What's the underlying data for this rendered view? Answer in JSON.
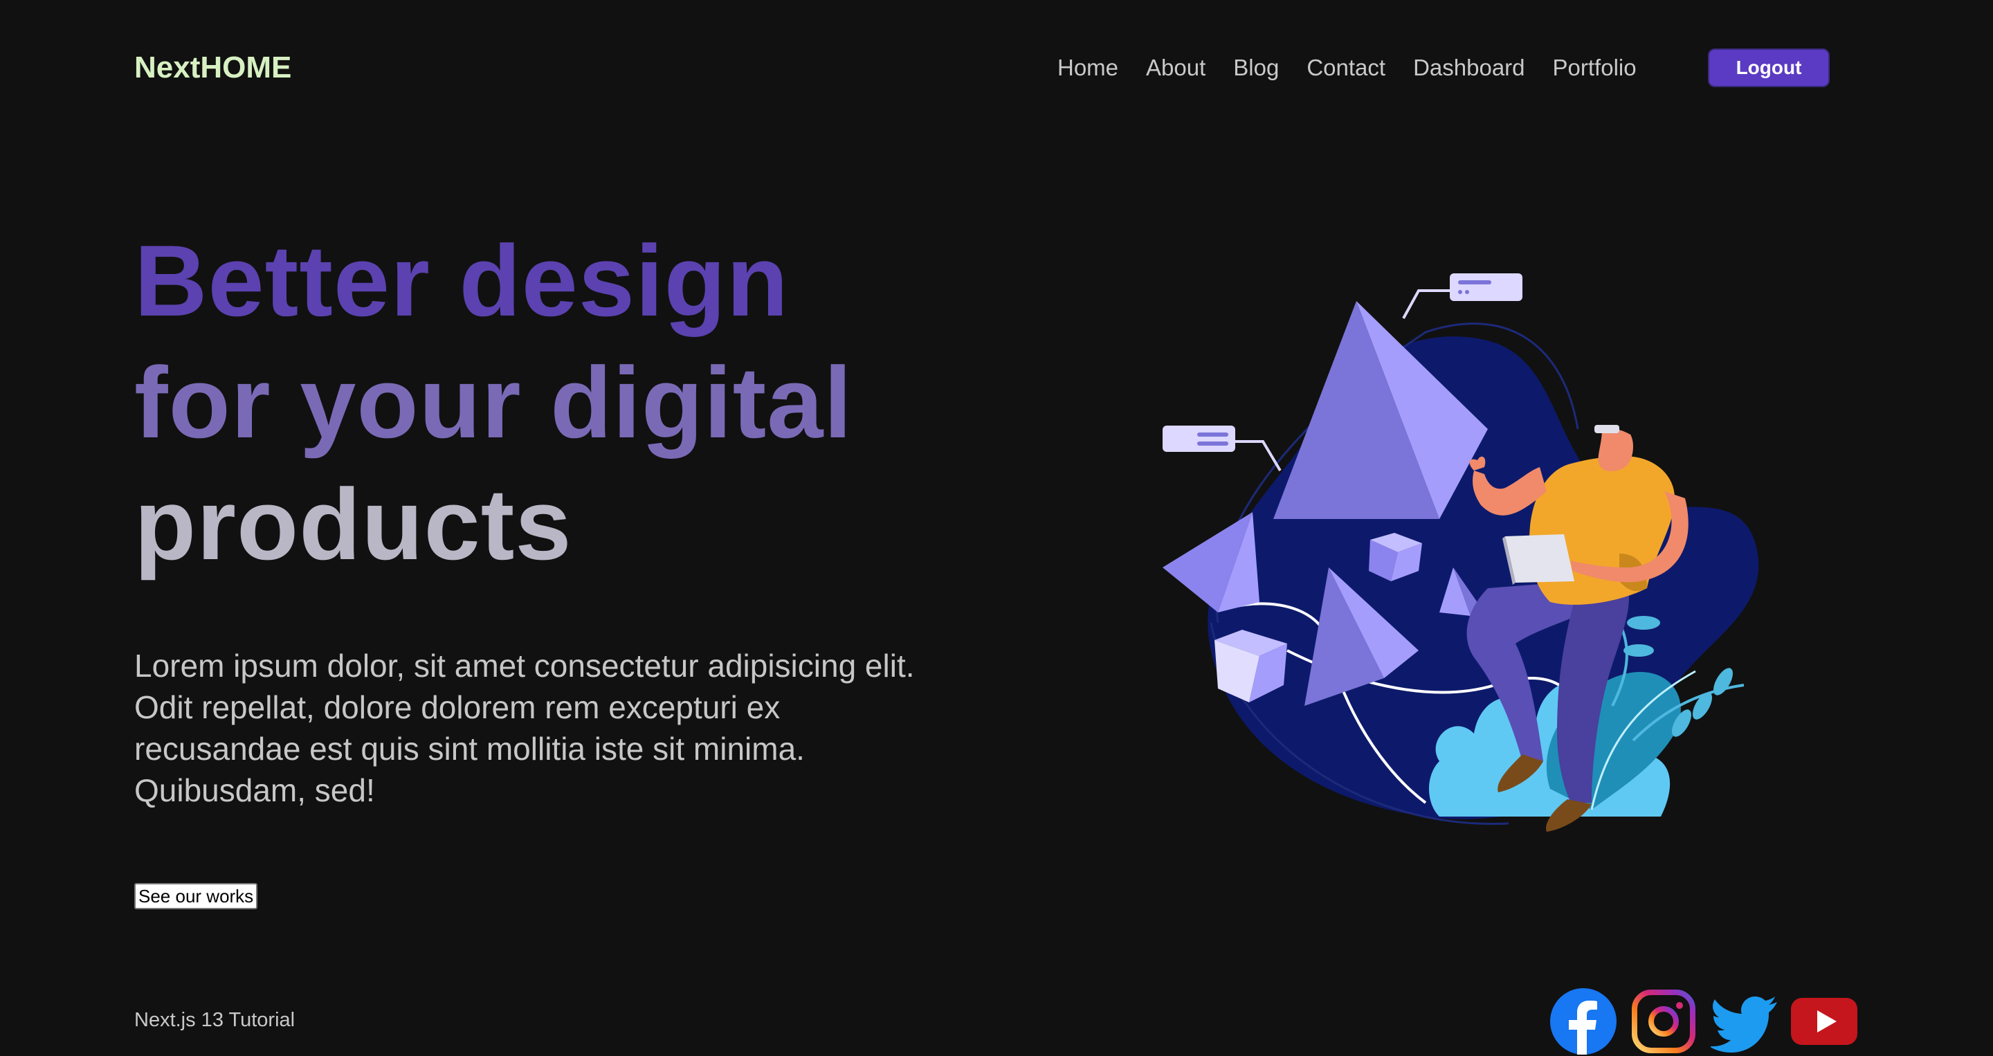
{
  "navbar": {
    "logo": "NextHOME",
    "links": [
      "Home",
      "About",
      "Blog",
      "Contact",
      "Dashboard",
      "Portfolio"
    ],
    "logout_label": "Logout"
  },
  "hero": {
    "title_lines": [
      "Better design",
      "for your digital",
      "products"
    ],
    "description": "Lorem ipsum dolor, sit amet consectetur adipisicing elit. Odit repellat, dolore dolorem rem excepturi ex recusandae est quis sint mollitia iste sit minima. Quibusdam, sed!",
    "cta_label": "See our works"
  },
  "footer": {
    "text": "Next.js 13 Tutorial",
    "socials": [
      "facebook-icon",
      "instagram-icon",
      "twitter-icon",
      "youtube-icon"
    ]
  },
  "colors": {
    "background": "#111111",
    "logo": "#d7f0c2",
    "accent": "#5b3bc4",
    "title_line1": "#5b42b0",
    "title_line2": "#7a6ab6",
    "title_line3": "#b9b6c5"
  }
}
